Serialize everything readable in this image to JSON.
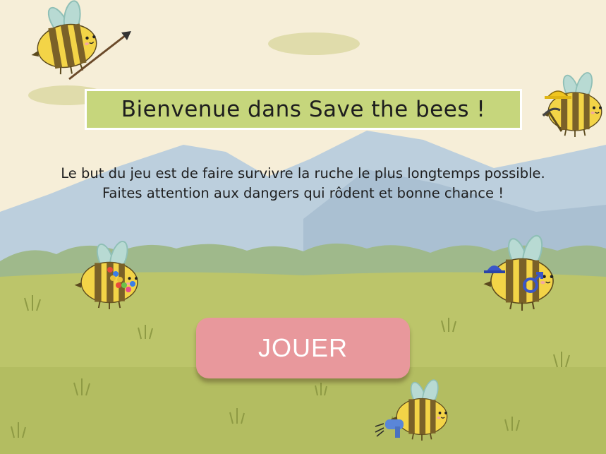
{
  "title": "Bienvenue dans Save the bees !",
  "description": {
    "line1": "Le but du jeu est de faire survivre la ruche le plus longtemps possible.",
    "line2": "Faites attention aux dangers qui rôdent et bonne chance !"
  },
  "play_button": {
    "label": "JOUER",
    "color": "#e8989c"
  },
  "colors": {
    "sky": "#f6eed8",
    "title_box": "#c6d67c",
    "mountains": "#bccfdd",
    "meadow": "#bcc56a",
    "bee_body": "#f3d447",
    "bee_stripe": "#7a6128",
    "wings": "#b8dad3"
  },
  "icons": [
    "spear-icon",
    "hard-hat-icon",
    "pickaxe-icon",
    "flower-lei-icon",
    "bowler-hat-icon",
    "male-symbol-icon",
    "hair-dryer-icon"
  ]
}
